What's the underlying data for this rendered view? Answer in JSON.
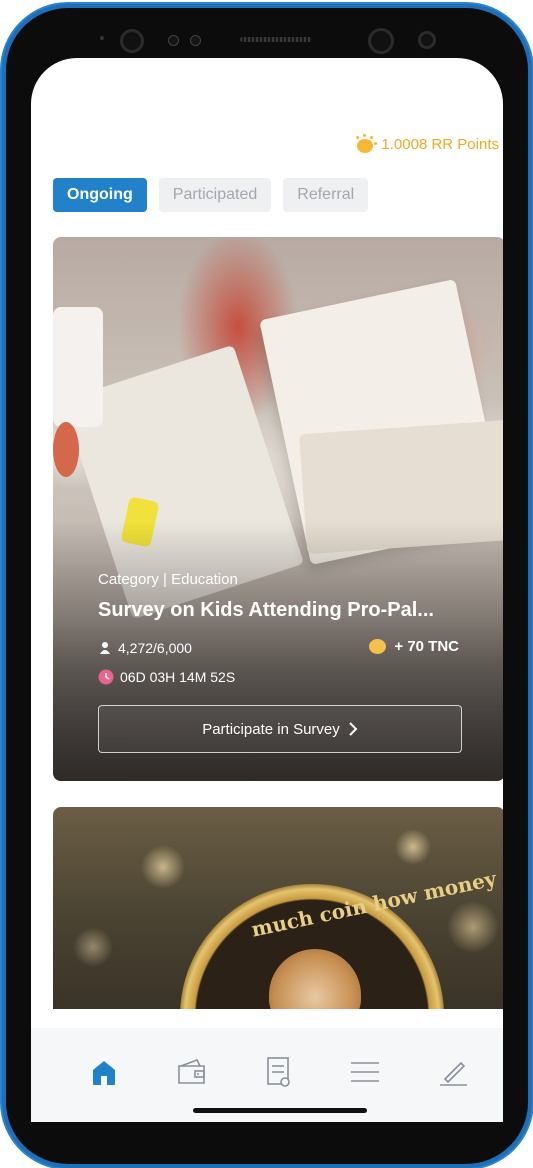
{
  "header": {
    "points_text": "1.0008 RR Points",
    "points_icon": "coin-sparkle-icon"
  },
  "tabs": [
    {
      "label": "Ongoing",
      "active": true
    },
    {
      "label": "Participated",
      "active": false
    },
    {
      "label": "Referral",
      "active": false
    }
  ],
  "surveys": [
    {
      "category": "Category | Education",
      "title": "Survey on Kids Attending Pro-Pal...",
      "participants": "4,272/6,000",
      "reward": "+ 70 TNC",
      "countdown": "06D 03H 14M 52S",
      "button_label": "Participate in Survey"
    },
    {
      "coin_text": "much coin how money"
    }
  ],
  "bottom_nav": [
    {
      "icon": "home-icon",
      "active": true
    },
    {
      "icon": "wallet-icon",
      "active": false
    },
    {
      "icon": "document-icon",
      "active": false
    },
    {
      "icon": "menu-icon",
      "active": false
    },
    {
      "icon": "pencil-icon",
      "active": false
    }
  ],
  "colors": {
    "accent": "#2182c9",
    "points": "#f3a920",
    "tab_inactive_bg": "#eff0f2",
    "tab_inactive_text": "#a3a6ad"
  }
}
